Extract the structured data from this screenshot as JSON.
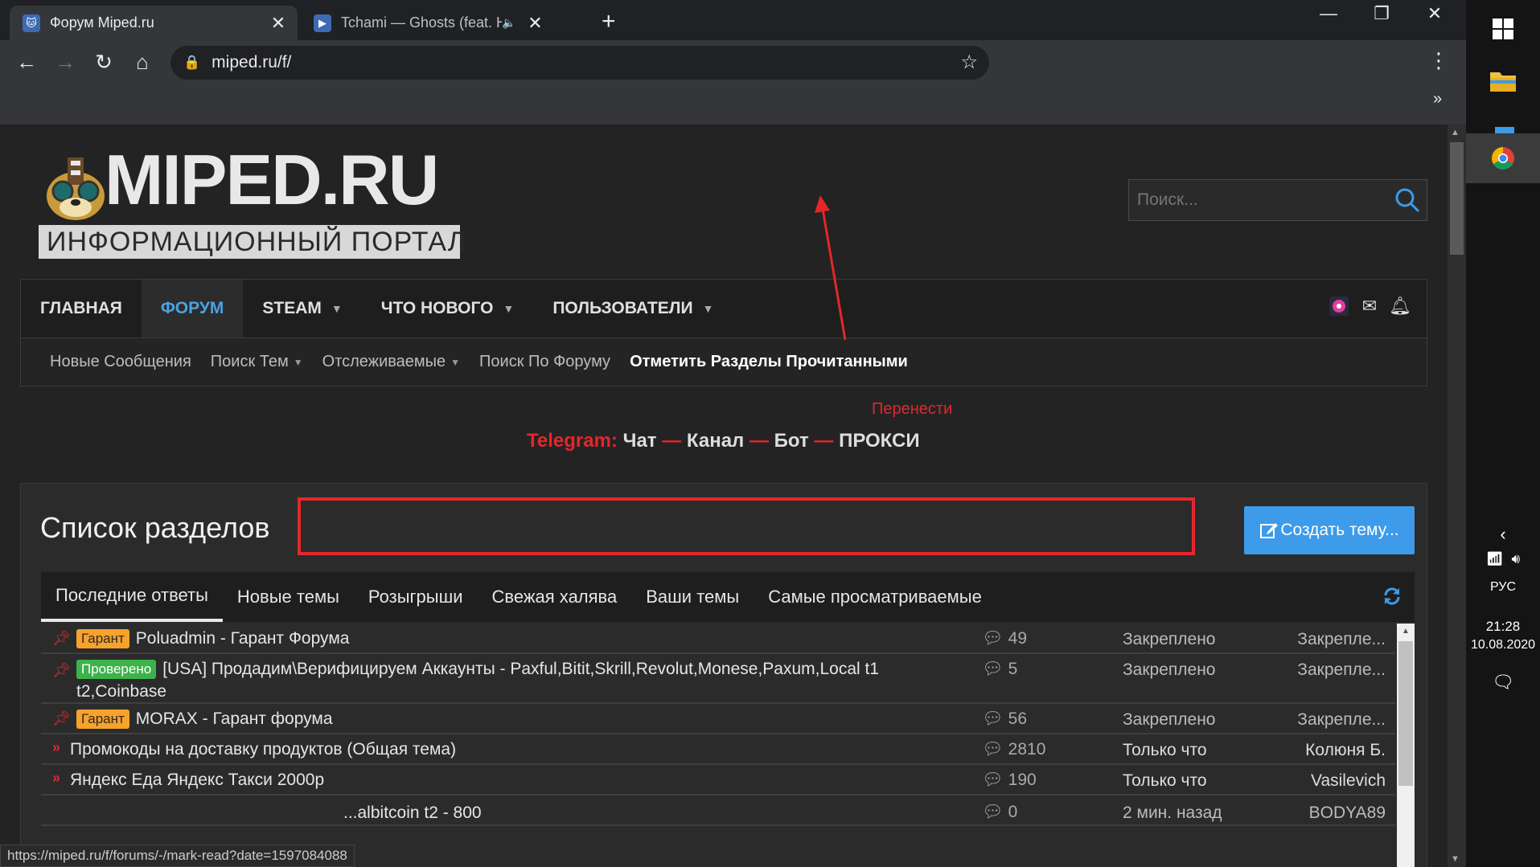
{
  "browser": {
    "tabs": [
      {
        "title": "Форум Miped.ru",
        "active": true,
        "favicon": "miped-cat-icon"
      },
      {
        "title": "Tchami — Ghosts (feat. Hana",
        "active": false,
        "favicon": "play-icon",
        "audio": true
      }
    ],
    "url": "miped.ru/f/",
    "new_tab_label": "+",
    "status_url": "https://miped.ru/f/forums/-/mark-read?date=1597084088"
  },
  "site": {
    "logo_main": "MIPED.RU",
    "logo_sub": "ИНФОРМАЦИОННЫЙ ПОРТАЛ",
    "search_placeholder": "Поиск...",
    "main_nav": [
      {
        "label": "Главная",
        "dropdown": false,
        "selected": false
      },
      {
        "label": "Форум",
        "dropdown": false,
        "selected": true
      },
      {
        "label": "STEAM",
        "dropdown": true,
        "selected": false
      },
      {
        "label": "Что нового",
        "dropdown": true,
        "selected": false
      },
      {
        "label": "Пользователи",
        "dropdown": true,
        "selected": false
      }
    ],
    "sub_nav": [
      {
        "label": "Новые Сообщения",
        "dropdown": false,
        "strong": false
      },
      {
        "label": "Поиск Тем",
        "dropdown": true,
        "strong": false
      },
      {
        "label": "Отслеживаемые",
        "dropdown": true,
        "strong": false
      },
      {
        "label": "Поиск По Форуму",
        "dropdown": false,
        "strong": false
      },
      {
        "label": "Отметить Разделы Прочитанными",
        "dropdown": false,
        "strong": true
      }
    ],
    "annotation": "Перенести",
    "telegram": {
      "prefix": "Telegram:",
      "links": [
        "Чат",
        "Канал",
        "Бот",
        "ПРОКСИ"
      ],
      "separator": "—"
    },
    "page_title": "Список разделов",
    "create_button": "Создать тему...",
    "tabs": [
      "Последние ответы",
      "Новые темы",
      "Розыгрыши",
      "Свежая халява",
      "Ваши темы",
      "Самые просматриваемые"
    ],
    "threads": [
      {
        "pinned": true,
        "badge": "Гарант",
        "badge_color": "orange",
        "title": "Poluadmin - Гарант Форума",
        "replies": "49",
        "when": "Закреплено",
        "who": "Закрепле..."
      },
      {
        "pinned": true,
        "badge": "Проверено",
        "badge_color": "green",
        "title": "[USA] Продадим\\Верифицируем Аккаунты - Paxful,Bitit,Skrill,Revolut,Monese,Paxum,Local t1 t2,Coinbase",
        "replies": "5",
        "when": "Закреплено",
        "who": "Закрепле..."
      },
      {
        "pinned": true,
        "badge": "Гарант",
        "badge_color": "orange",
        "title": "MORAX - Гарант форума",
        "replies": "56",
        "when": "Закреплено",
        "who": "Закрепле..."
      },
      {
        "pinned": false,
        "badge": "",
        "title": "Промокоды на доставку продуктов (Общая тема)",
        "replies": "2810",
        "when": "Только что",
        "who": "Колюня Б."
      },
      {
        "pinned": false,
        "badge": "",
        "title": "Яндекс Еда Яндекс Такси 2000р",
        "replies": "190",
        "when": "Только что",
        "who": "Vasilevich"
      },
      {
        "pinned": false,
        "badge": "",
        "title": "...albitcoin t2 - 800",
        "replies": "0",
        "when": "2 мин. назад",
        "who": "BODYA89"
      }
    ]
  },
  "taskbar": {
    "language": "РУС",
    "time": "21:28",
    "date": "10.08.2020"
  },
  "colors": {
    "accent": "#3d9be9",
    "annotation_red": "#e5262a",
    "badge_orange": "#f7a22b",
    "badge_green": "#3cb34a"
  }
}
